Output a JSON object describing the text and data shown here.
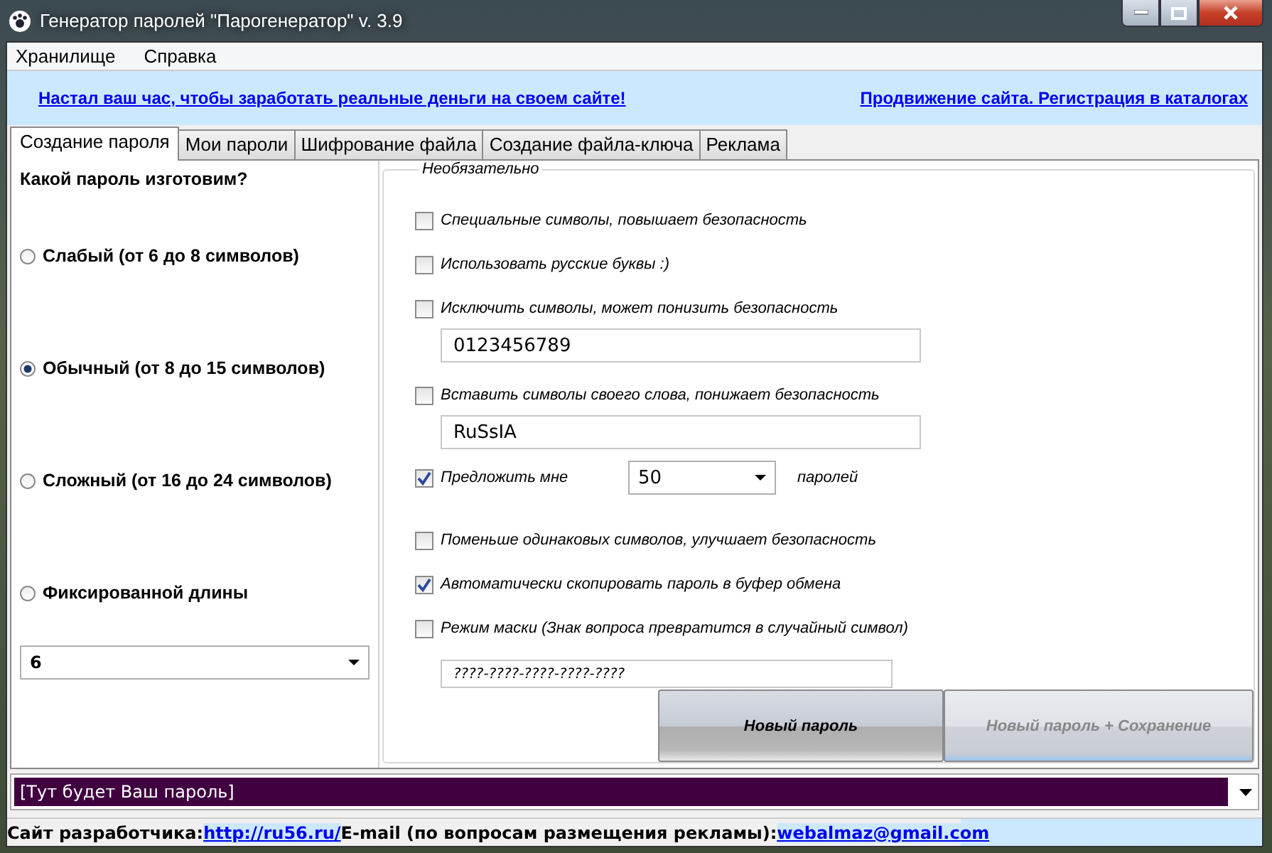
{
  "window": {
    "title": "Генератор паролей \"Парогенератор\" v. 3.9"
  },
  "menu": [
    "Хранилище",
    "Справка"
  ],
  "banner": {
    "left_link": "Настал ваш час, чтобы заработать реальные деньги на своем сайте!",
    "right_link": "Продвижение сайта. Регистрация в каталогах"
  },
  "tabs": [
    {
      "label": "Создание пароля",
      "selected": true
    },
    {
      "label": "Мои пароли",
      "selected": false
    },
    {
      "label": "Шифрование файла",
      "selected": false
    },
    {
      "label": "Создание файла-ключа",
      "selected": false
    },
    {
      "label": "Реклама",
      "selected": false
    }
  ],
  "strength": {
    "title": "Какой пароль изготовим?",
    "options": [
      {
        "label": "Слабый (от 6 до 8 символов)",
        "selected": false
      },
      {
        "label": "Обычный (от 8 до 15 символов)",
        "selected": true
      },
      {
        "label": "Сложный (от 16 до 24 символов)",
        "selected": false
      },
      {
        "label": "Фиксированной длины",
        "selected": false
      }
    ],
    "length": "6"
  },
  "optional": {
    "title": "Необязательно",
    "options": [
      {
        "kind": "check",
        "label": "Специальные символы, повышает безопасность",
        "checked": false
      },
      {
        "kind": "check",
        "label": "Использовать русские буквы :)",
        "checked": false
      },
      {
        "kind": "field",
        "label": "Исключить символы, может понизить безопасность",
        "checked": false,
        "value": "0123456789"
      },
      {
        "kind": "field",
        "label": "Вставить символы своего слова, понижает безопасность",
        "checked": false,
        "value": "RuSsIA"
      },
      {
        "kind": "select",
        "label": "Предложить мне",
        "checked": true,
        "value": "50",
        "suffix": "паролей"
      },
      {
        "kind": "check",
        "label": "Поменьше одинаковых символов, улучшает безопасность",
        "checked": false
      },
      {
        "kind": "check",
        "label": "Автоматически скопировать пароль в буфер обмена",
        "checked": true
      },
      {
        "kind": "mask",
        "label": "Режим маски (Знак вопроса превратится в случайный символ)",
        "checked": false,
        "value": "????-????-????-????-????"
      }
    ]
  },
  "buttons": [
    {
      "label": "Новый пароль",
      "disabled": false
    },
    {
      "label": "Новый пароль + Сохранение",
      "disabled": true
    }
  ],
  "password_output": "[Тут будет Ваш пароль]",
  "status_bar": {
    "site_label": "Сайт разработчика:",
    "site_link": "http://ru56.ru/",
    "email_label": "E-mail (по вопросам размещения рекламы):",
    "email_link": "webalmaz@gmail.com"
  }
}
